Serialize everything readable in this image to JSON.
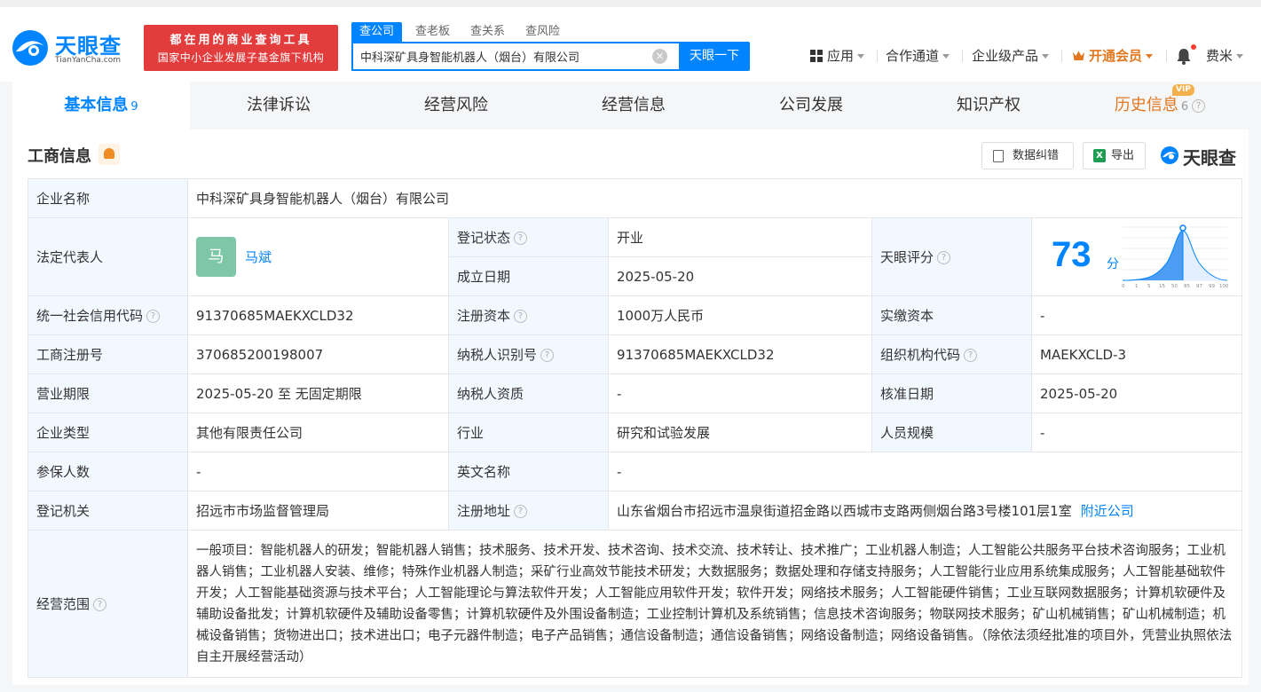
{
  "header": {
    "logo_cn": "天眼查",
    "logo_en": "TianYanCha.com",
    "slogan_line1": "都在用的商业查询工具",
    "slogan_line2": "国家中小企业发展子基金旗下机构",
    "search_tabs": [
      "查公司",
      "查老板",
      "查关系",
      "查风险"
    ],
    "search_value": "中科深矿具身智能机器人（烟台）有限公司",
    "search_button": "天眼一下",
    "nav": [
      "应用",
      "合作通道",
      "企业级产品",
      "开通会员",
      "费米"
    ]
  },
  "tabs": [
    {
      "label": "基本信息",
      "count": "9"
    },
    {
      "label": "法律诉讼",
      "count": ""
    },
    {
      "label": "经营风险",
      "count": ""
    },
    {
      "label": "经营信息",
      "count": ""
    },
    {
      "label": "公司发展",
      "count": ""
    },
    {
      "label": "知识产权",
      "count": ""
    },
    {
      "label": "历史信息",
      "count": "6",
      "badge": "VIP"
    }
  ],
  "section": {
    "title": "工商信息",
    "btn_correct": "数据纠错",
    "btn_export": "导出",
    "brand": "天眼查"
  },
  "info": {
    "company_name_label": "企业名称",
    "company_name": "中科深矿具身智能机器人（烟台）有限公司",
    "legal_rep_label": "法定代表人",
    "legal_rep_avatar": "马",
    "legal_rep": "马斌",
    "reg_status_label": "登记状态",
    "reg_status": "开业",
    "found_date_label": "成立日期",
    "found_date": "2025-05-20",
    "score_label": "天眼评分",
    "score": "73",
    "score_unit": "分",
    "score_ticks": [
      "0",
      "1",
      "5",
      "15",
      "50",
      "85",
      "97",
      "99",
      "100"
    ],
    "credit_code_label": "统一社会信用代码",
    "credit_code": "91370685MAEKXCLD32",
    "reg_capital_label": "注册资本",
    "reg_capital": "1000万人民币",
    "paid_capital_label": "实缴资本",
    "paid_capital": "-",
    "reg_no_label": "工商注册号",
    "reg_no": "370685200198007",
    "taxpayer_id_label": "纳税人识别号",
    "taxpayer_id": "91370685MAEKXCLD32",
    "org_code_label": "组织机构代码",
    "org_code": "MAEKXCLD-3",
    "term_label": "营业期限",
    "term": "2025-05-20 至 无固定期限",
    "taxpayer_qual_label": "纳税人资质",
    "taxpayer_qual": "-",
    "approve_date_label": "核准日期",
    "approve_date": "2025-05-20",
    "type_label": "企业类型",
    "type": "其他有限责任公司",
    "industry_label": "行业",
    "industry": "研究和试验发展",
    "staff_size_label": "人员规模",
    "staff_size": "-",
    "insured_label": "参保人数",
    "insured": "-",
    "en_name_label": "英文名称",
    "en_name": "-",
    "authority_label": "登记机关",
    "authority": "招远市市场监督管理局",
    "address_label": "注册地址",
    "address": "山东省烟台市招远市温泉街道招金路以西城市支路两侧烟台路3号楼101层1室",
    "nearby": "附近公司",
    "scope_label": "经营范围",
    "scope": "一般项目：智能机器人的研发；智能机器人销售；技术服务、技术开发、技术咨询、技术交流、技术转让、技术推广；工业机器人制造；人工智能公共服务平台技术咨询服务；工业机器人销售；工业机器人安装、维修；特殊作业机器人制造；采矿行业高效节能技术研发；大数据服务；数据处理和存储支持服务；人工智能行业应用系统集成服务；人工智能基础软件开发；人工智能基础资源与技术平台；人工智能理论与算法软件开发；人工智能应用软件开发；软件开发；网络技术服务；人工智能硬件销售；工业互联网数据服务；计算机软硬件及辅助设备批发；计算机软硬件及辅助设备零售；计算机软硬件及外围设备制造；工业控制计算机及系统销售；信息技术咨询服务；物联网技术服务；矿山机械销售；矿山机械制造；机械设备销售；货物进出口；技术进出口；电子元器件制造；电子产品销售；通信设备制造；通信设备销售；网络设备制造；网络设备销售。（除依法须经批准的项目外，凭营业执照依法自主开展经营活动）"
  },
  "colors": {
    "brand_blue": "#0084ff",
    "slogan_red": "#e23c3c",
    "vip_orange": "#e2771e",
    "status_green": "#2bb36a",
    "label_bg": "#f2f8ff"
  }
}
